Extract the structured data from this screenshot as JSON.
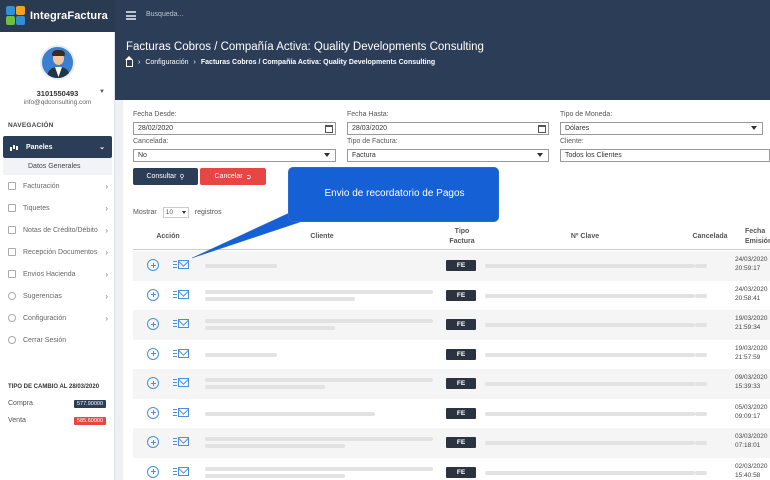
{
  "app": {
    "name": "IntegraFactura",
    "search_placeholder": "Busqueda..."
  },
  "colors": {
    "navy": "#2c3e57",
    "accent": "#1560d4",
    "cancel": "#e84545"
  },
  "user": {
    "id": "3101550493",
    "email": "info@qdconsulting.com"
  },
  "sidebar": {
    "heading": "NAVEGACIÓN",
    "active": {
      "label": "Paneles",
      "icon": "chart-icon"
    },
    "sub_item": "Datos Generales",
    "items": [
      {
        "label": "Facturación",
        "icon": "invoice-icon"
      },
      {
        "label": "Tiquetes",
        "icon": "ticket-icon"
      },
      {
        "label": "Notas de Crédito/Débito",
        "icon": "note-icon"
      },
      {
        "label": "Recepción Documentos",
        "icon": "inbox-icon"
      },
      {
        "label": "Envios Hacienda",
        "icon": "send-icon"
      },
      {
        "label": "Sugerencias",
        "icon": "bulb-icon"
      },
      {
        "label": "Configuración",
        "icon": "gear-icon"
      },
      {
        "label": "Cerrar Sesión",
        "icon": "logout-icon"
      }
    ],
    "exchange": {
      "heading": "TIPO DE CAMBIO AL 28/03/2020",
      "compra_label": "Compra",
      "compra_value": "577.90000",
      "venta_label": "Venta",
      "venta_value": "585.60000"
    }
  },
  "header": {
    "title": "Facturas Cobros / Compañía Activa: Quality Developments Consulting",
    "breadcrumb": [
      "Configuración",
      "Facturas Cobros / Compañía Activa: Quality Developments Consulting"
    ]
  },
  "filters": {
    "fecha_desde": {
      "label": "Fecha Desde:",
      "value": "28/02/2020"
    },
    "fecha_hasta": {
      "label": "Fecha Hasta:",
      "value": "28/03/2020"
    },
    "moneda": {
      "label": "Tipo de Moneda:",
      "value": "Dólares"
    },
    "cancelada": {
      "label": "Cancelada:",
      "value": "No"
    },
    "tipo_factura": {
      "label": "Tipo de Factura:",
      "value": "Factura"
    },
    "cliente": {
      "label": "Cliente:",
      "value": "Todos los Clientes"
    }
  },
  "buttons": {
    "consultar": "Consultar",
    "cancelar": "Cancelar"
  },
  "table": {
    "show_label": "Mostrar",
    "page_size": "10",
    "registros_label": "registros",
    "headers": {
      "accion": "Acción",
      "cliente": "Cliente",
      "tipo1": "Tipo",
      "tipo2": "Factura",
      "clave": "Nº Clave",
      "cancelada": "Cancelada",
      "fecha1": "Fecha",
      "fecha2": "Emisión"
    },
    "rows": [
      {
        "tipo": "FE",
        "fecha": "24/03/2020",
        "hora": "20:59:17"
      },
      {
        "tipo": "FE",
        "fecha": "24/03/2020",
        "hora": "20:58:41"
      },
      {
        "tipo": "FE",
        "fecha": "19/03/2020",
        "hora": "21:59:34"
      },
      {
        "tipo": "FE",
        "fecha": "19/03/2020",
        "hora": "21:57:59"
      },
      {
        "tipo": "FE",
        "fecha": "09/03/2020",
        "hora": "15:39:33"
      },
      {
        "tipo": "FE",
        "fecha": "05/03/2020",
        "hora": "09:09:17"
      },
      {
        "tipo": "FE",
        "fecha": "03/03/2020",
        "hora": "07:18:01"
      },
      {
        "tipo": "FE",
        "fecha": "02/03/2020",
        "hora": "15:40:58"
      }
    ]
  },
  "callout": {
    "text": "Envio de recordatorio de Pagos"
  }
}
